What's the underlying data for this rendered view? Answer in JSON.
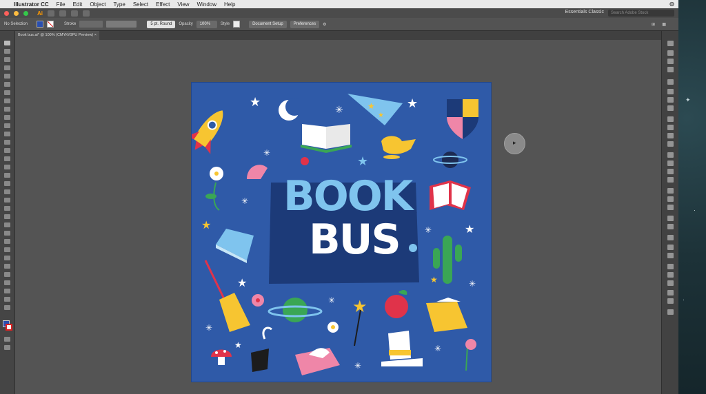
{
  "menubar": {
    "app_name": "Illustrator CC",
    "menus": [
      "File",
      "Edit",
      "Object",
      "Type",
      "Select",
      "Effect",
      "View",
      "Window",
      "Help"
    ]
  },
  "appbar": {
    "workspace": "Essentials Classic",
    "search_placeholder": "Search Adobe Stock"
  },
  "control_bar": {
    "selection": "No Selection",
    "stroke_label": "Stroke",
    "brush_value": "5 pt. Round",
    "opacity_label": "Opacity",
    "opacity_value": "100%",
    "style_label": "Style",
    "document_setup": "Document Setup",
    "preferences": "Preferences"
  },
  "document_tab": {
    "label": "Book bus.ai* @ 100% (CMYK/GPU Preview)"
  },
  "artboard": {
    "title_line1": "BOOK",
    "title_line2": "BUS",
    "background_color": "#2f5aa8"
  },
  "colors": {
    "accent_blue": "#7fc4ee",
    "accent_yellow": "#f7c531",
    "accent_red": "#e0334a"
  }
}
